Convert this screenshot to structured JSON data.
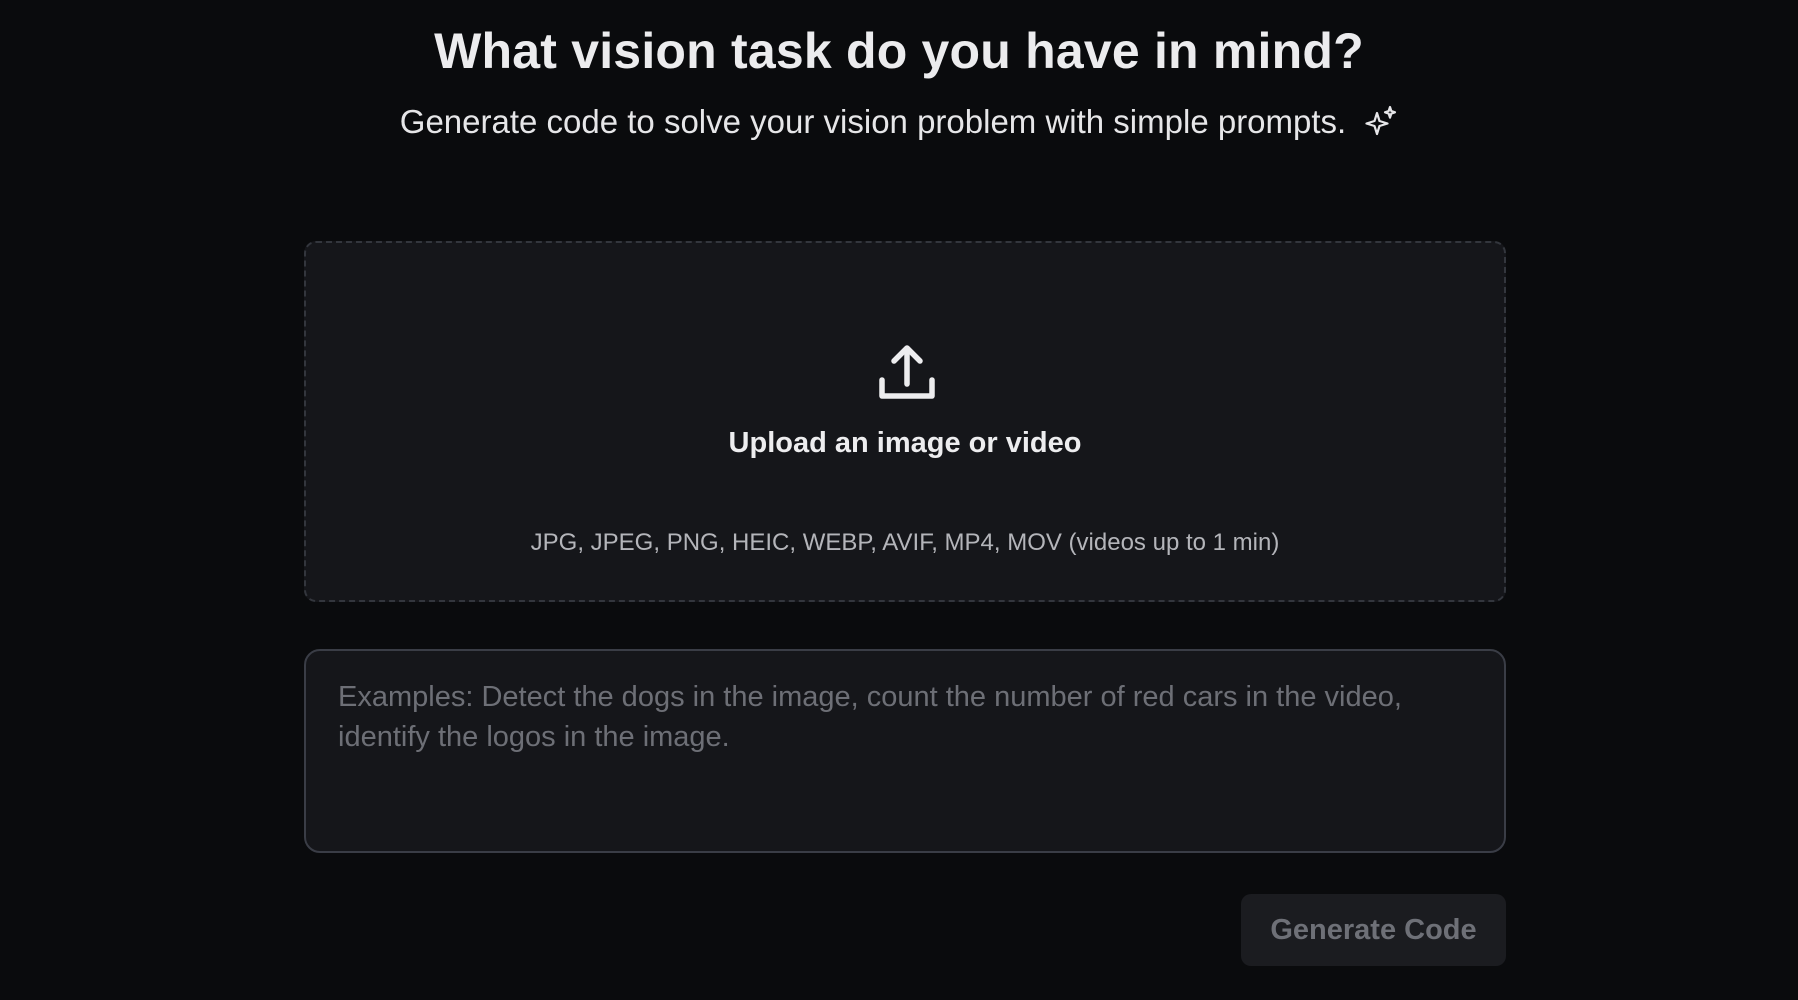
{
  "header": {
    "title": "What vision task do you have in mind?",
    "subtitle": "Generate code to solve your vision problem with simple prompts."
  },
  "upload": {
    "label": "Upload an image or video",
    "formats": "JPG, JPEG, PNG, HEIC, WEBP, AVIF, MP4, MOV (videos up to 1 min)",
    "icon": "upload-icon"
  },
  "prompt": {
    "value": "",
    "placeholder": "Examples: Detect the dogs in the image, count the number of red cars in the video, identify the logos in the image."
  },
  "actions": {
    "generate_label": "Generate Code",
    "generate_enabled": false
  },
  "icons": {
    "subtitle_icon": "sparkle-icon"
  },
  "colors": {
    "background": "#0a0b0d",
    "panel": "#15161a",
    "text": "#ececee",
    "muted": "#b4b5ba",
    "placeholder": "#6d6f76",
    "button_bg": "#1b1c20",
    "button_text": "#6e7077"
  }
}
